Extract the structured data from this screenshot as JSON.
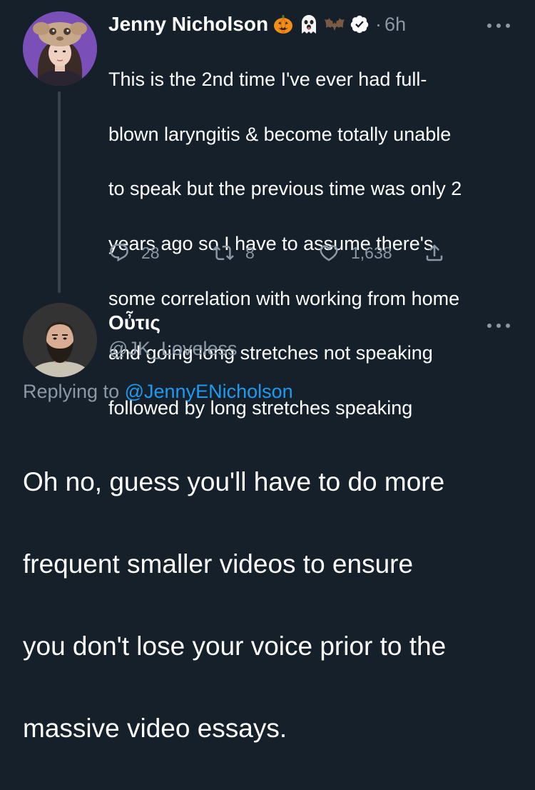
{
  "tweets": [
    {
      "author": {
        "display_name": "Jenny Nicholson",
        "badges": [
          "pumpkin-emoji",
          "ghost-emoji",
          "bat-emoji",
          "verified-badge"
        ],
        "separator": "·",
        "timestamp": "6h"
      },
      "body_lines": [
        "This is the 2nd time I've ever had full-",
        "blown laryngitis & become totally unable",
        "to speak but the previous time was only 2",
        "years ago so I have to assume there's",
        "some correlation with working from home",
        "and going long stretches not speaking",
        "followed by long stretches speaking"
      ],
      "actions": {
        "replies": "28",
        "retweets": "8",
        "likes": "1,638"
      }
    },
    {
      "author": {
        "display_name": "Oὖτις",
        "handle": "@JK_Loveless"
      },
      "replying_prefix": "Replying to",
      "replying_to": "@JennyENicholson",
      "body_lines": [
        "Oh no, guess you'll have to do more",
        "frequent smaller videos to ensure",
        "you don't lose your voice prior to the",
        "massive video essays."
      ]
    }
  ],
  "colors": {
    "background": "#15202b",
    "text_primary": "#ffffff",
    "text_secondary": "#8b98a5",
    "link": "#1d9bf0",
    "thread_line": "#38444d"
  },
  "icons": {
    "more": "more-horizontal-icon",
    "reply": "reply-icon",
    "retweet": "retweet-icon",
    "like": "heart-icon",
    "share": "share-icon"
  }
}
